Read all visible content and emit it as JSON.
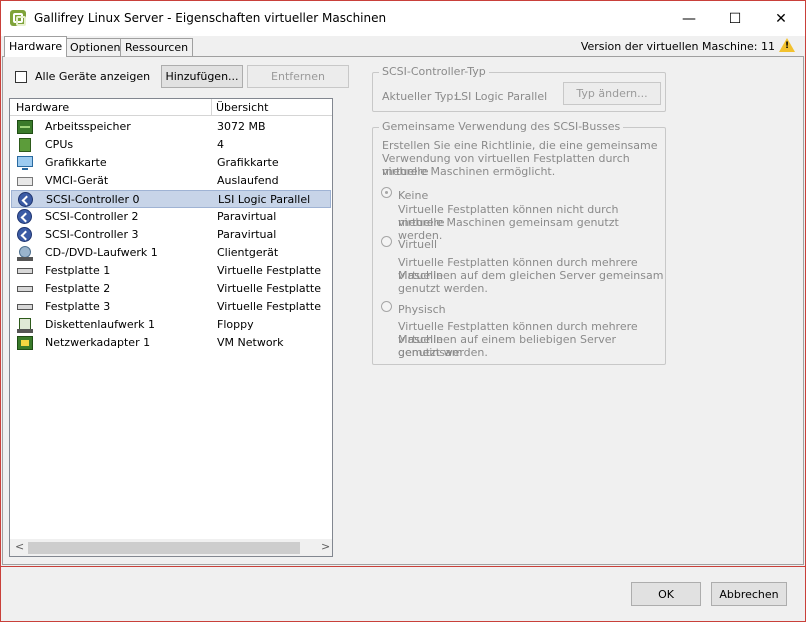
{
  "window": {
    "title": "Gallifrey Linux Server - Eigenschaften virtueller Maschinen",
    "minimize": "—",
    "maximize": "☐",
    "close": "✕"
  },
  "tabs": [
    {
      "label": "Hardware",
      "active": true
    },
    {
      "label": "Optionen",
      "active": false
    },
    {
      "label": "Ressourcen",
      "active": false
    }
  ],
  "vm_version": "Version der virtuellen Maschine: 11",
  "warning_icon": "warning-icon",
  "hardware_panel": {
    "show_all_label": "Alle Geräte anzeigen",
    "add_button": "Hinzufügen...",
    "remove_button": "Entfernen",
    "columns": [
      "Hardware",
      "Übersicht"
    ],
    "items": [
      {
        "name": "Arbeitsspeicher",
        "summary": "3072 MB",
        "icon": "memory-icon"
      },
      {
        "name": "CPUs",
        "summary": "4",
        "icon": "cpu-icon"
      },
      {
        "name": "Grafikkarte",
        "summary": "Grafikkarte",
        "icon": "display-icon"
      },
      {
        "name": "VMCI-Gerät",
        "summary": "Auslaufend",
        "icon": "vmci-icon"
      },
      {
        "name": "SCSI-Controller 0",
        "summary": "LSI Logic Parallel",
        "icon": "scsi-icon",
        "selected": true
      },
      {
        "name": "SCSI-Controller 2",
        "summary": "Paravirtual",
        "icon": "scsi-icon"
      },
      {
        "name": "SCSI-Controller 3",
        "summary": "Paravirtual",
        "icon": "scsi-icon"
      },
      {
        "name": "CD-/DVD-Laufwerk 1",
        "summary": "Clientgerät",
        "icon": "cd-drive-icon"
      },
      {
        "name": "Festplatte 1",
        "summary": "Virtuelle Festplatte",
        "icon": "hard-disk-icon"
      },
      {
        "name": "Festplatte 2",
        "summary": "Virtuelle Festplatte",
        "icon": "hard-disk-icon"
      },
      {
        "name": "Festplatte 3",
        "summary": "Virtuelle Festplatte",
        "icon": "hard-disk-icon"
      },
      {
        "name": "Diskettenlaufwerk 1",
        "summary": "Floppy",
        "icon": "floppy-icon"
      },
      {
        "name": "Netzwerkadapter 1",
        "summary": "VM Network",
        "icon": "network-icon"
      }
    ],
    "scroll_left": "<",
    "scroll_right": ">"
  },
  "scsi_type": {
    "title": "SCSI-Controller-Typ",
    "current_label": "Aktueller Typ:",
    "current_value": "LSI Logic Parallel",
    "change_button": "Typ ändern..."
  },
  "bus_sharing": {
    "title": "Gemeinsame Verwendung des SCSI-Busses",
    "description": [
      "Erstellen Sie eine Richtlinie, die eine gemeinsame",
      "Verwendung von virtuellen Festplatten durch mehrere",
      "virtuelle Maschinen ermöglicht."
    ],
    "options": [
      {
        "label": "Keine",
        "checked": true,
        "desc": [
          "Virtuelle Festplatten können nicht durch mehrere",
          "virtuelle Maschinen gemeinsam genutzt werden."
        ]
      },
      {
        "label": "Virtuell",
        "checked": false,
        "desc": [
          "Virtuelle Festplatten können durch mehrere virtuelle",
          "Maschinen auf dem gleichen Server gemeinsam",
          "genutzt werden."
        ]
      },
      {
        "label": "Physisch",
        "checked": false,
        "desc": [
          "Virtuelle Festplatten können durch mehrere virtuelle",
          "Maschinen auf einem beliebigen Server gemeinsam",
          "genutzt werden."
        ]
      }
    ]
  },
  "footer": {
    "ok_button": "OK",
    "cancel_button": "Abbrechen"
  }
}
